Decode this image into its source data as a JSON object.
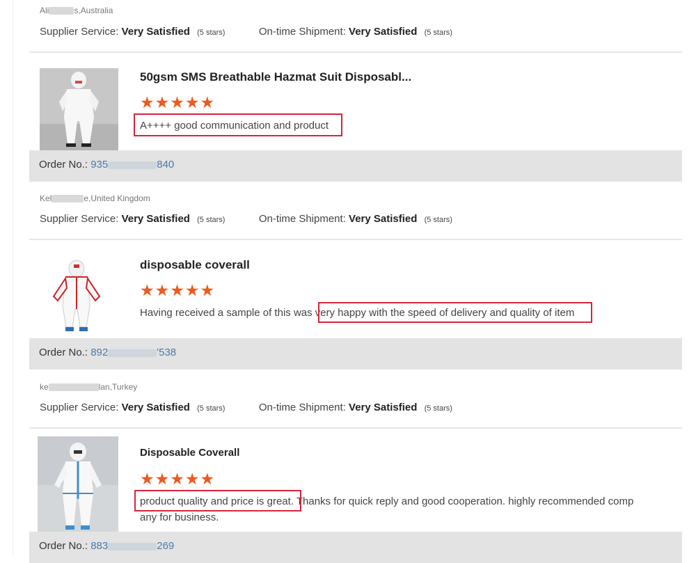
{
  "reviews": [
    {
      "location_prefix": "Ali",
      "location_suffix": "s,Australia",
      "supplier_label": "Supplier Service:",
      "supplier_value": "Very Satisfied",
      "supplier_stars": "(5 stars)",
      "shipment_label": "On-time Shipment:",
      "shipment_value": "Very Satisfied",
      "shipment_stars": "(5 stars)"
    },
    {
      "product_title": "50gsm SMS Breathable Hazmat Suit Disposabl...",
      "rating": 5,
      "stars": "★★★★★",
      "review_text": "A++++ good communication and product",
      "order_label": "Order No.:",
      "order_prefix": "935",
      "order_suffix": "840",
      "location_prefix": "Kel",
      "location_suffix": "e,United Kingdom",
      "supplier_label": "Supplier Service:",
      "supplier_value": "Very Satisfied",
      "supplier_stars": "(5 stars)",
      "shipment_label": "On-time Shipment:",
      "shipment_value": "Very Satisfied",
      "shipment_stars": "(5 stars)"
    },
    {
      "product_title": "disposable coverall",
      "rating": 5,
      "stars": "★★★★★",
      "review_text_plain": "Having received a sample of this was",
      "review_text_highlight": "very happy with the speed of delivery and quality of item",
      "order_label": "Order No.:",
      "order_prefix": "892",
      "order_suffix": "'538",
      "location_prefix": "ke",
      "location_suffix": "lan,Turkey",
      "supplier_label": "Supplier Service:",
      "supplier_value": "Very Satisfied",
      "supplier_stars": "(5 stars)",
      "shipment_label": "On-time Shipment:",
      "shipment_value": "Very Satisfied",
      "shipment_stars": "(5 stars)"
    },
    {
      "product_title": "Disposable Coverall",
      "rating": 5,
      "stars": "★★★★★",
      "review_text_highlight": "product quality and price is great.",
      "review_text_rest": " Thanks for quick reply and good cooperation. highly recommended comp",
      "review_text_line2": "any for business.",
      "order_label": "Order No.:",
      "order_prefix": "883",
      "order_suffix": "269"
    }
  ],
  "colors": {
    "star": "#ee5a1d",
    "highlight_box": "#d5243a",
    "order_link": "#4a78ae",
    "order_bar": "#e3e3e3"
  }
}
